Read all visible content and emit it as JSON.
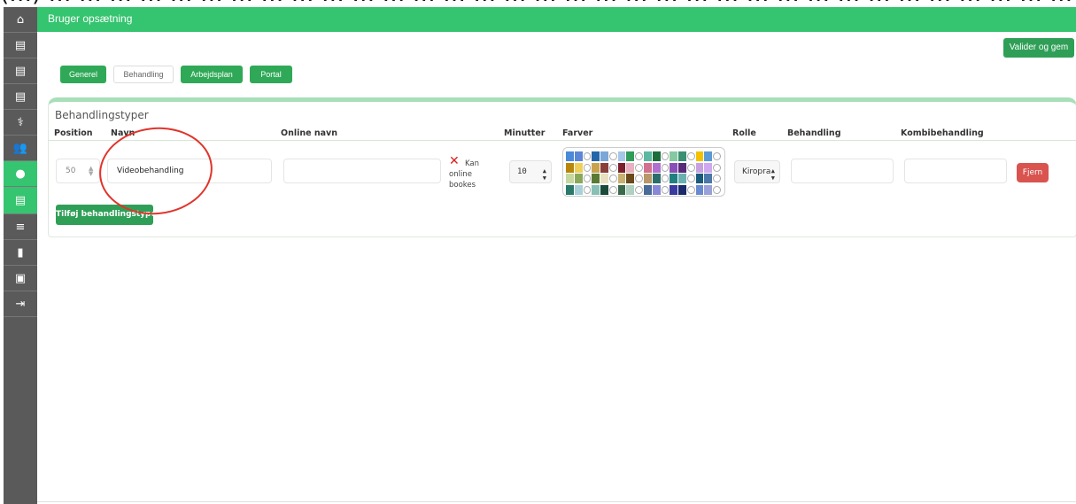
{
  "caption_fragment": "(…) … … … … … … … … … … … … … … … … … … … … … … … … … … … … … … … … … … … … … … … … … … … … … … … … … … … g)",
  "app": {
    "title": "Bruger opsætning",
    "validate_button": "Valider og gem"
  },
  "tabs": [
    {
      "label": "Generel",
      "state": "green"
    },
    {
      "label": "Behandling",
      "state": "selected"
    },
    {
      "label": "Arbejdsplan",
      "state": "green"
    },
    {
      "label": "Portal",
      "state": "green"
    }
  ],
  "section": {
    "title": "Behandlingstyper",
    "columns": [
      "Position",
      "Navn",
      "Online navn",
      "Minutter",
      "Farver",
      "Rolle",
      "Behandling",
      "Kombibehandling"
    ]
  },
  "row": {
    "position": "50",
    "name": "Videobehandling",
    "online_name": "",
    "online_bookable_label": "Kan online bookes",
    "online_bookable_state": "not-bookable",
    "minutes": "10",
    "role": "Kiropra",
    "treatment": "",
    "combo_treatment": "",
    "remove_button": "Fjern"
  },
  "palette_colors": [
    [
      "#4a8ad8",
      "#5c86d6",
      "#2266aa",
      "#7aa6d8",
      "#a4c7e8",
      "#2f9c5a",
      "#5cb8a0",
      "#1b6e3b",
      "#86c9a0",
      "#3b8f73",
      "#f2c200",
      "#5b9bd5"
    ],
    [
      "#b8860b",
      "#efcf58",
      "#c9a24e",
      "#8a3f3a",
      "#7b1f2b",
      "#e8b0c0",
      "#d27090",
      "#b070d0",
      "#8a4fb6",
      "#5a2a7a",
      "#c8a0e0",
      "#d0a8f0"
    ],
    [
      "#c5d8a0",
      "#8aa85a",
      "#5a7a33",
      "#e8e0c0",
      "#c8b070",
      "#6a4a1a",
      "#b89868",
      "#2a6e6a",
      "#208080",
      "#6ab0b0",
      "#1a5a7a",
      "#4a78a8"
    ],
    [
      "#2a7a6a",
      "#a8d0d8",
      "#88c0b8",
      "#1a4a3a",
      "#3a6a4a",
      "#b0d0c0",
      "#4a6a9a",
      "#8888d8",
      "#3a3aa0",
      "#1a2a6a",
      "#6a8ad0",
      "#9aa0d8"
    ]
  ],
  "add_button": "Tilføj behandlingstype",
  "sidebar_icons": [
    "home-icon",
    "clipboard-icon",
    "clipboard-icon",
    "clipboard-icon",
    "caduceus-icon",
    "users-icon",
    "chat-icon",
    "clipboard-icon",
    "list-icon",
    "file-icon",
    "archive-icon",
    "logout-icon"
  ]
}
